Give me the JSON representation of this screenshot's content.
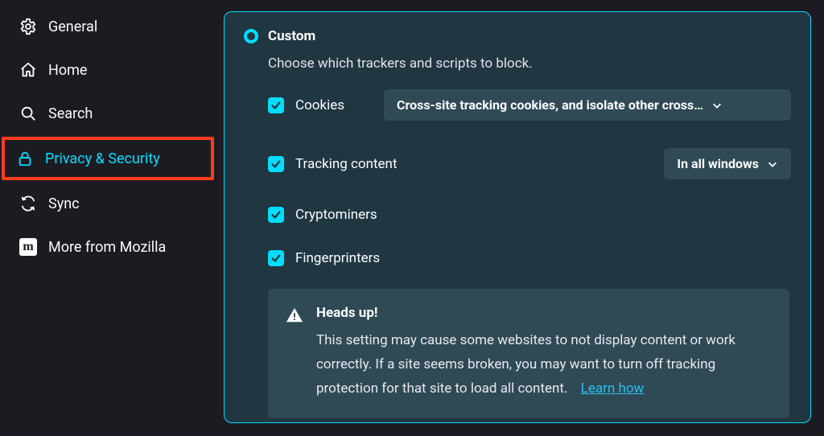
{
  "sidebar": {
    "items": [
      {
        "label": "General"
      },
      {
        "label": "Home"
      },
      {
        "label": "Search"
      },
      {
        "label": "Privacy & Security"
      },
      {
        "label": "Sync"
      },
      {
        "label": "More from Mozilla"
      }
    ]
  },
  "panel": {
    "radio_label": "Custom",
    "subtitle": "Choose which trackers and scripts to block.",
    "options": {
      "cookies": {
        "label": "Cookies",
        "select": "Cross-site tracking cookies, and isolate other cross…"
      },
      "tracking": {
        "label": "Tracking content",
        "select": "In all windows"
      },
      "crypto": {
        "label": "Cryptominers"
      },
      "fingerprint": {
        "label": "Fingerprinters"
      }
    },
    "alert": {
      "title": "Heads up!",
      "text": "This setting may cause some websites to not display content or work correctly. If a site seems broken, you may want to turn off tracking protection for that site to load all content.",
      "link": "Learn how"
    }
  },
  "colors": {
    "accent": "#00ddff",
    "highlight_border": "#ff3b1f"
  }
}
